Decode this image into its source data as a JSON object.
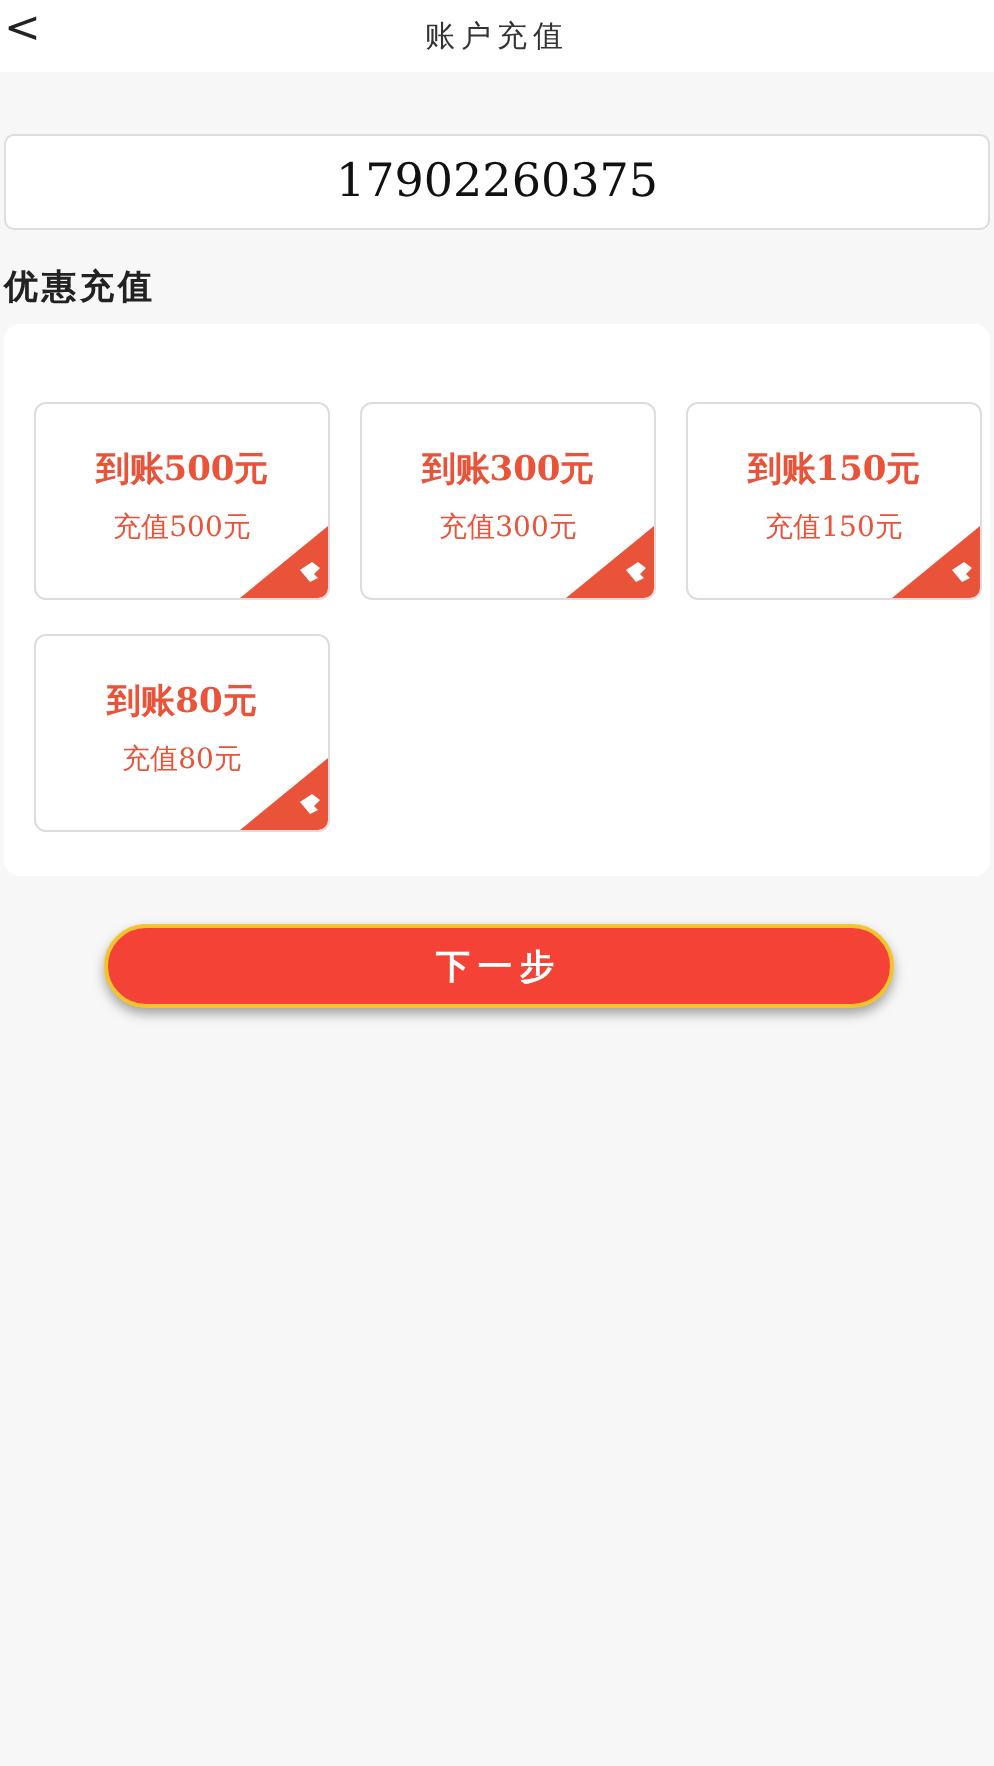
{
  "header": {
    "back": "<",
    "title": "账户充值"
  },
  "account": {
    "value": "17902260375"
  },
  "section_title": "优惠充值",
  "packages": [
    {
      "credit": "到账500元",
      "price": "充值500元"
    },
    {
      "credit": "到账300元",
      "price": "充值300元"
    },
    {
      "credit": "到账150元",
      "price": "充值150元"
    },
    {
      "credit": "到账80元",
      "price": "充值80元"
    }
  ],
  "next_button": "下一步"
}
